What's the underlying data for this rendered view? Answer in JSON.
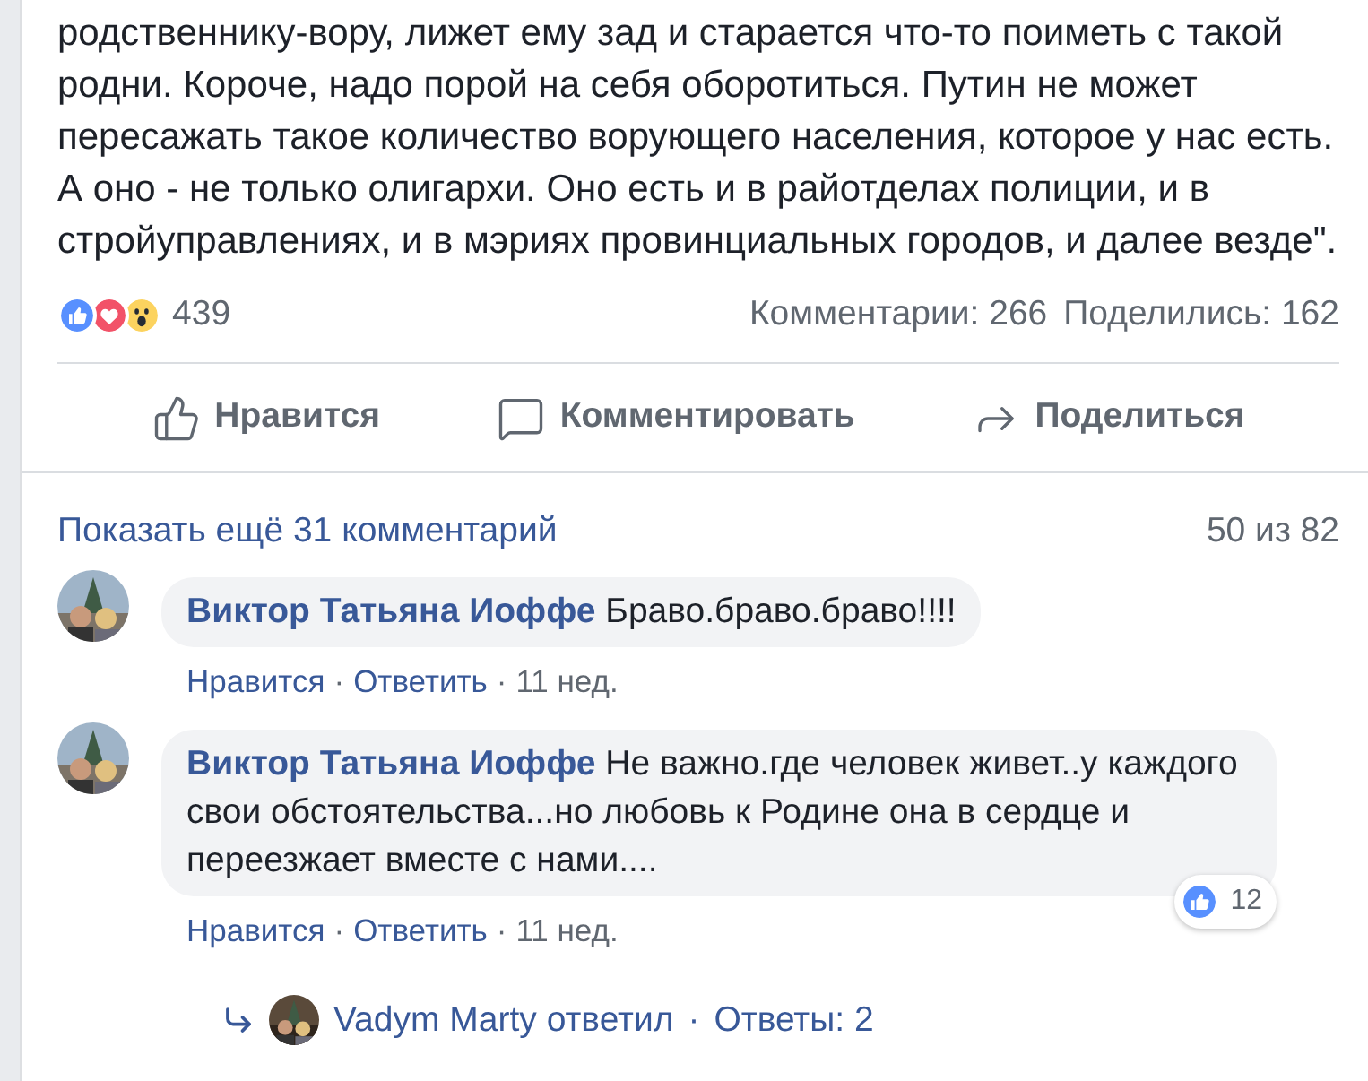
{
  "post": {
    "text_lines": [
      "родственнику-вору, лижет ему зад и старается что-то поиметь с такой",
      "родни. Короче, надо порой на себя оборотиться. Путин не может",
      "пересажать такое количество ворующего населения, которое у нас есть.",
      "А оно - не только олигархи. Оно есть и в райотделах полиции, и в",
      "стройуправлениях, и в мэриях провинциальных городов, и далее везде\"."
    ],
    "reactions": [
      {
        "kind": "like"
      },
      {
        "kind": "love"
      },
      {
        "kind": "wow"
      }
    ],
    "reaction_count": "439",
    "comments_count": "Комментарии: 266",
    "shares_count": "Поделились: 162",
    "actions": [
      {
        "kind": "like",
        "label": "Нравится"
      },
      {
        "kind": "comment",
        "label": "Комментировать"
      },
      {
        "kind": "share",
        "label": "Поделиться"
      }
    ]
  },
  "comments_section": {
    "show_more": "Показать ещё 31 комментарий",
    "counter": "50 из 82",
    "separator": "·",
    "comments": [
      {
        "author": "Виктор Татьяна Иоффе",
        "text": "Браво.браво.браво!!!!",
        "like": "Нравится",
        "reply": "Ответить",
        "time": "11 нед."
      },
      {
        "author": "Виктор Татьяна Иоффе",
        "text": "Не важно.где человек живет..у каждого свои обстоятельства...но любовь к Родине она в сердце и переезжает вместе с нами....",
        "like": "Нравится",
        "reply": "Ответить",
        "time": "11 нед.",
        "likes": "12",
        "replies": {
          "author": "Vadym Marty ответил",
          "count": "Ответы: 2"
        }
      }
    ]
  }
}
